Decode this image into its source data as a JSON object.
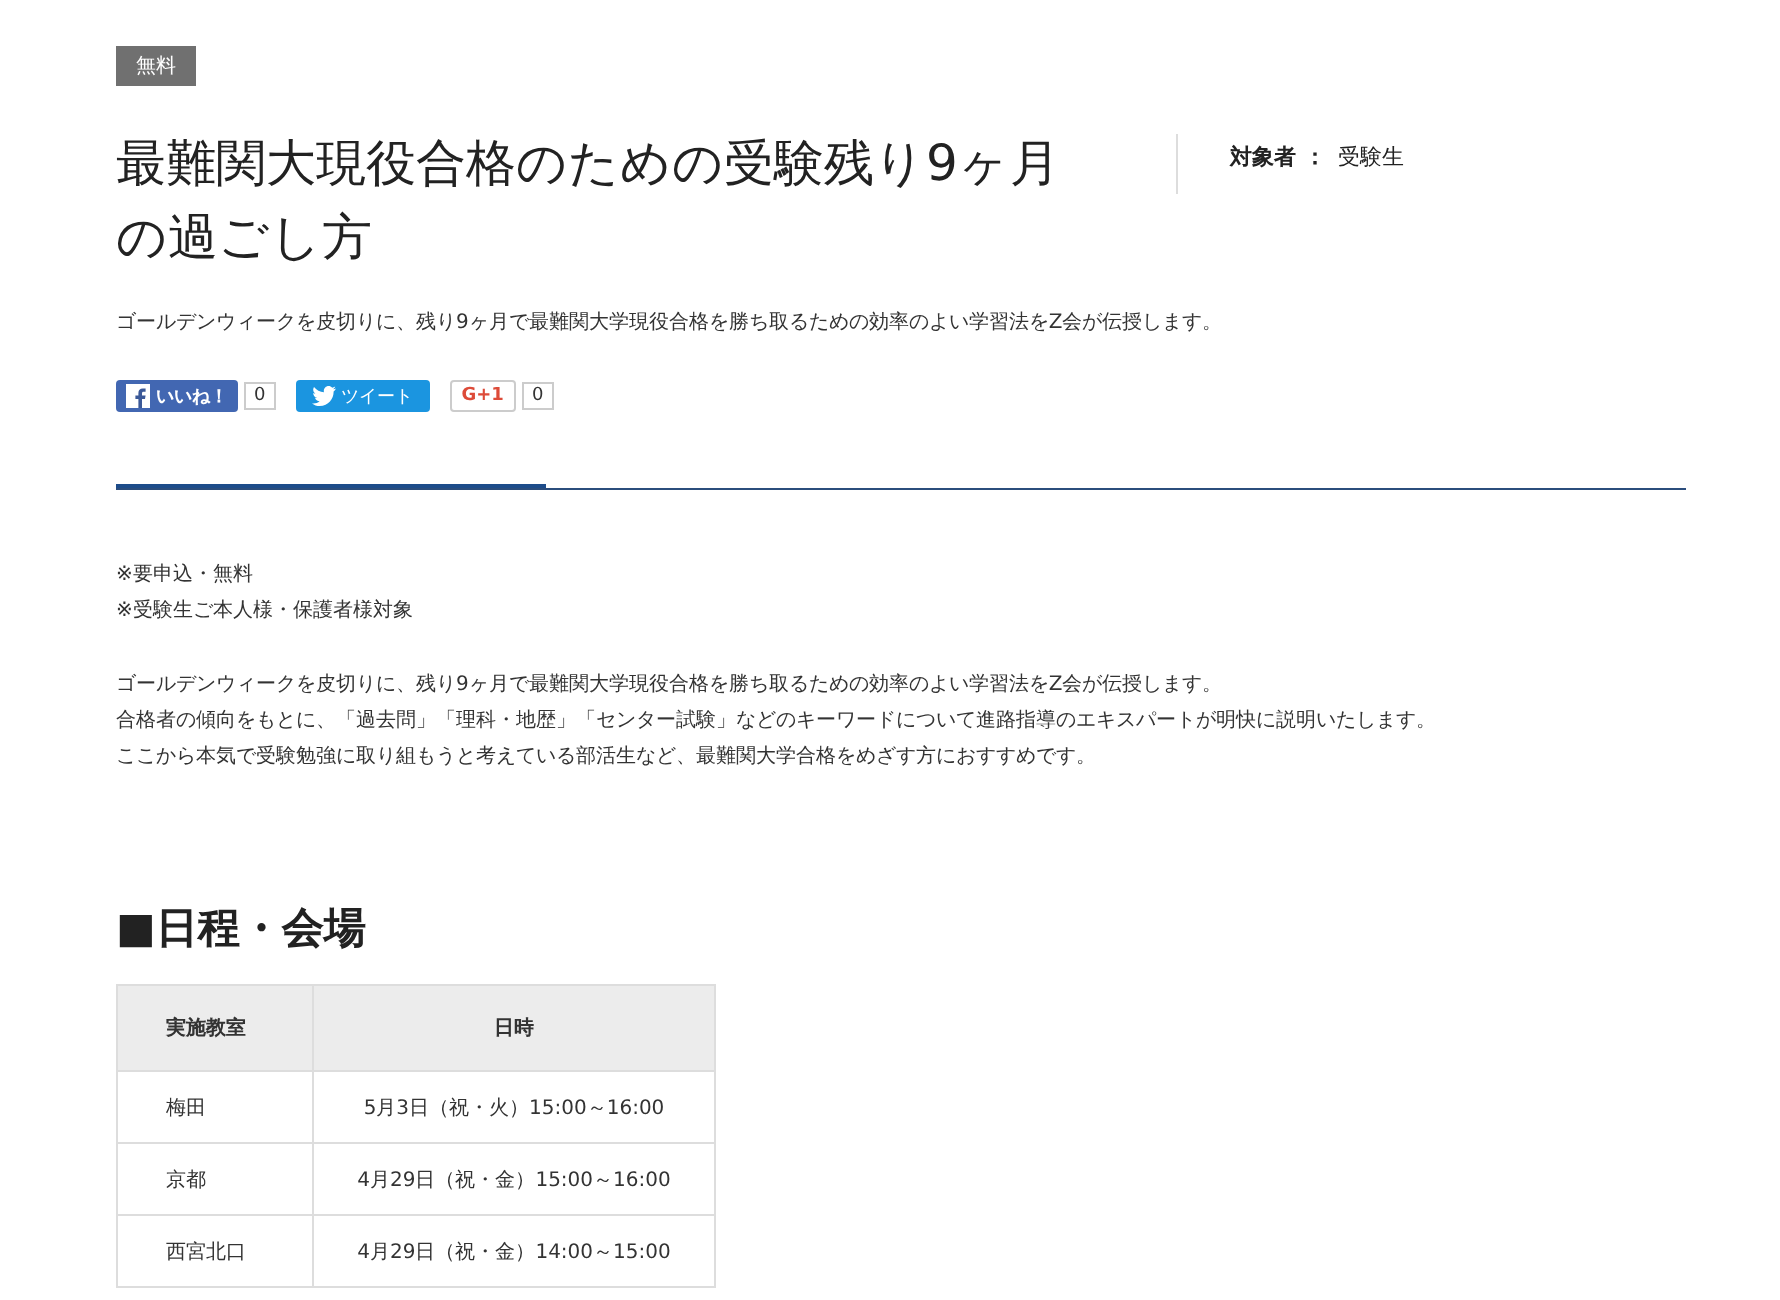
{
  "badge": "無料",
  "title": "最難関大現役合格のための受験残り9ヶ月の過ごし方",
  "audience": {
    "label": "対象者",
    "separator": "：",
    "value": "受験生"
  },
  "description": "ゴールデンウィークを皮切りに、残り9ヶ月で最難関大学現役合格を勝ち取るための効率のよい学習法をZ会が伝授します。",
  "social": [
    {
      "kind": "facebook",
      "label": "いいね！",
      "count": "0"
    },
    {
      "kind": "twitter",
      "label": "ツイート"
    },
    {
      "kind": "google",
      "label": "G+1",
      "count": "0"
    }
  ],
  "notes": [
    "※要申込・無料",
    "※受験生ご本人様・保護者様対象"
  ],
  "paragraph": [
    "ゴールデンウィークを皮切りに、残り9ヶ月で最難関大学現役合格を勝ち取るための効率のよい学習法をZ会が伝授します。",
    "合格者の傾向をもとに、「過去問」「理科・地歴」「センター試験」などのキーワードについて進路指導のエキスパートが明快に説明いたします。",
    "ここから本気で受験勉強に取り組もうと考えている部活生など、最難関大学合格をめざす方におすすめです。"
  ],
  "schedule": {
    "heading": "■日程・会場",
    "columns": [
      "実施教室",
      "日時"
    ],
    "rows": [
      [
        "梅田",
        "5月3日（祝・火）15:00～16:00"
      ],
      [
        "京都",
        "4月29日（祝・金）15:00～16:00"
      ],
      [
        "西宮北口",
        "4月29日（祝・金）14:00～15:00"
      ]
    ]
  }
}
